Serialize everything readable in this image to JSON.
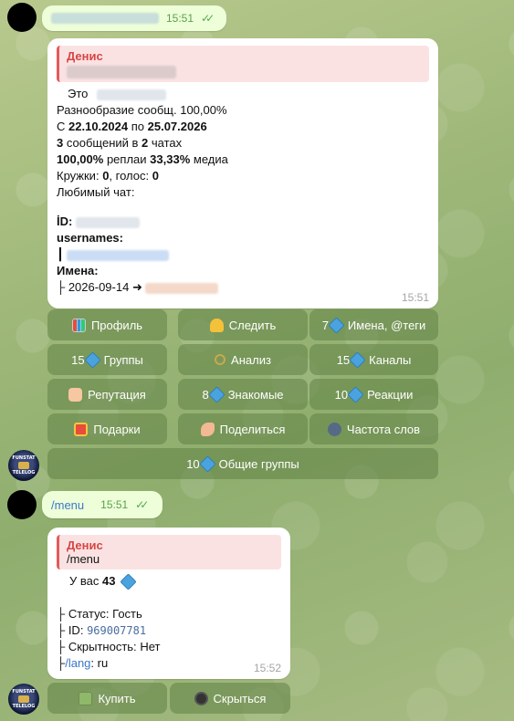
{
  "top_message": {
    "time": "15:51",
    "checks": "✓✓"
  },
  "profile_message": {
    "reply_name": "Денис",
    "eto_label": "Это",
    "diversity": "Разнообразие сообщ. 100,00%",
    "period_prefix": "С",
    "period_from": "22.10.2024",
    "period_mid": "по",
    "period_to": "25.07.2026",
    "messages_count": "3",
    "messages_mid": "сообщений в",
    "chats_count": "2",
    "chats_label": "чатах",
    "replies_pct": "100,00%",
    "replies_label": "реплаи",
    "media_pct": "33,33%",
    "media_label": "медиа",
    "circles_label": "Кружки:",
    "circles_value": "0",
    "voice_label": ", голос:",
    "voice_value": "0",
    "fav_chat_label": "Любимый чат:",
    "id_label": "İD:",
    "usernames_label": "usernames:",
    "usernames_prefix": "┃",
    "names_label": "Имена:",
    "names_entry_prefix": "├ 2026-09-14",
    "arrow": "➜",
    "time": "15:51"
  },
  "keyboard1": [
    {
      "label": "Профиль",
      "icon": "bar-chart-icon"
    },
    {
      "label": "Следить",
      "icon": "bell-icon"
    },
    {
      "label": "7",
      "label2": "Имена, @теги",
      "icon": "diamond-icon"
    },
    {
      "label": "15",
      "label2": "Группы",
      "icon": "diamond-icon"
    },
    {
      "label": "Анализ",
      "icon": "magnifier-icon"
    },
    {
      "label": "15",
      "label2": "Каналы",
      "icon": "diamond-icon"
    },
    {
      "label": "Репутация",
      "icon": "thumbs-up-icon"
    },
    {
      "label": "8",
      "label2": "Знакомые",
      "icon": "diamond-icon"
    },
    {
      "label": "10",
      "label2": "Реакции",
      "icon": "diamond-icon"
    },
    {
      "label": "Подарки",
      "icon": "gift-icon"
    },
    {
      "label": "Поделиться",
      "icon": "hand-icon"
    },
    {
      "label": "Частота слов",
      "icon": "speech-icon"
    },
    {
      "label": "10",
      "label2": "Общие группы",
      "icon": "diamond-icon"
    }
  ],
  "bot_avatar_text": [
    "FUNSTAT",
    "TELELOG"
  ],
  "menu_message": {
    "text": "/menu",
    "time": "15:51",
    "checks": "✓✓"
  },
  "status_message": {
    "reply_name": "Денис",
    "reply_text": "/menu",
    "balance_prefix": "У вас",
    "balance_value": "43",
    "status_label": "├ Статус:",
    "status_value": "Гость",
    "id_label": "├ ID:",
    "id_value": "969007781",
    "hidden_label": "├ Скрытность:",
    "hidden_value": "Нет",
    "lang_prefix": "├",
    "lang_link": "/lang",
    "lang_value": ": ru",
    "time": "15:52"
  },
  "keyboard2": [
    {
      "label": "Купить",
      "icon": "money-icon"
    },
    {
      "label": "Скрыться",
      "icon": "ninja-icon"
    }
  ]
}
